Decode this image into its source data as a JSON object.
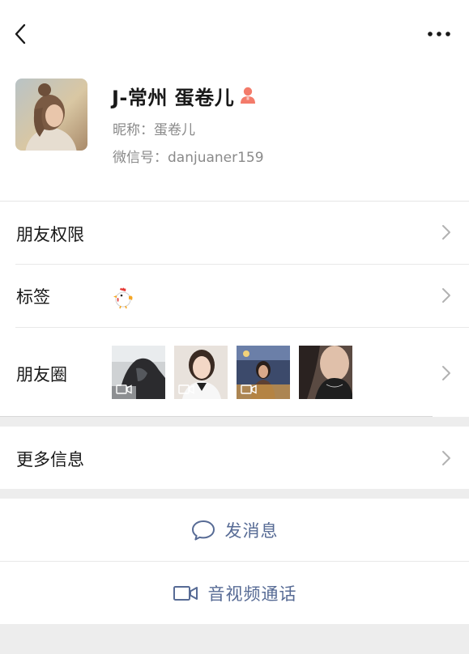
{
  "header": {
    "back_icon": "chevron-left-icon",
    "more_icon": "more-dots-icon"
  },
  "profile": {
    "display_name": "J-常州 蛋卷儿",
    "gender_icon": "female-icon",
    "gender_color": "#f37b6a",
    "nickname_line": "昵称：蛋卷儿",
    "wechat_id_line": "微信号：danjuaner159"
  },
  "rows": {
    "friend_permissions": "朋友权限",
    "tags": "标签",
    "tag_icon": "rooster-emoji-icon",
    "moments": "朋友圈",
    "more_info": "更多信息"
  },
  "moments_thumbs": [
    {
      "name": "moment-thumb-1",
      "has_video": true
    },
    {
      "name": "moment-thumb-2",
      "has_video": true
    },
    {
      "name": "moment-thumb-3",
      "has_video": true
    },
    {
      "name": "moment-thumb-4",
      "has_video": false
    }
  ],
  "actions": {
    "send_message": "发消息",
    "message_icon": "chat-bubble-icon",
    "video_call": "音视频通话",
    "video_icon": "video-camera-icon",
    "link_color": "#576b95"
  }
}
